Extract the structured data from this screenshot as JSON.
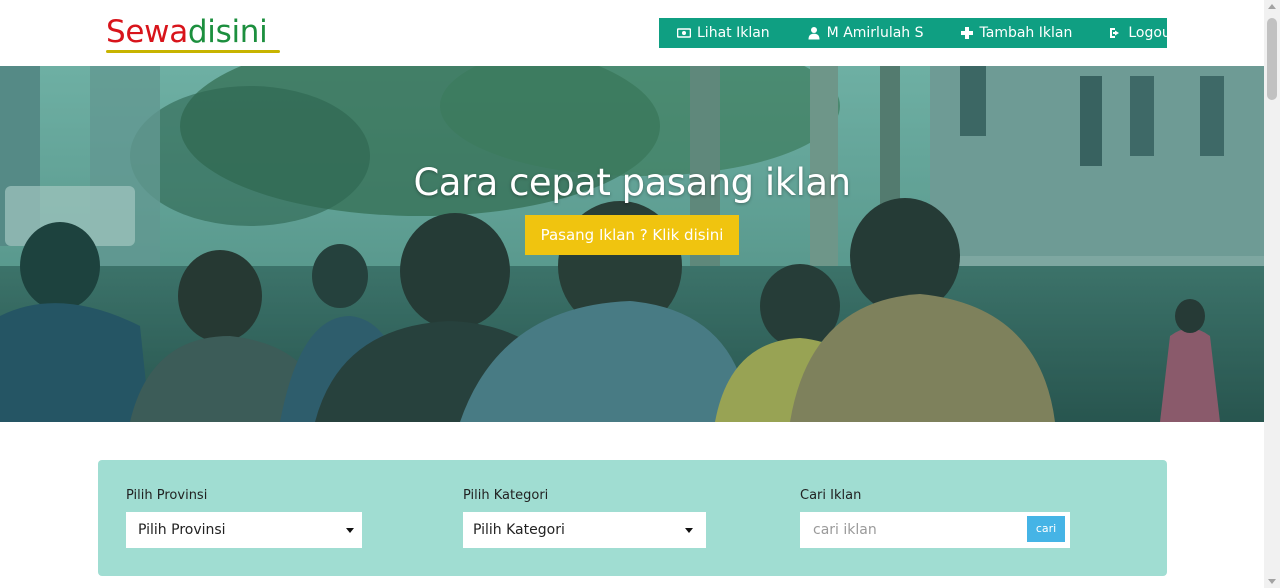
{
  "brand": {
    "part1": "Sewa",
    "part2": "disini"
  },
  "nav": {
    "items": [
      {
        "label": "Lihat Iklan"
      },
      {
        "label": "M Amirlulah S"
      },
      {
        "label": "Tambah Iklan"
      },
      {
        "label": "Logout"
      }
    ]
  },
  "hero": {
    "title": "Cara cepat pasang iklan",
    "button_label": "Pasang Iklan ? Klik disini"
  },
  "search": {
    "province": {
      "label": "Pilih Provinsi",
      "value": "Pilih Provinsi"
    },
    "category": {
      "label": "Pilih Kategori",
      "value": "Pilih Kategori"
    },
    "query": {
      "label": "Cari Iklan",
      "placeholder": "cari iklan",
      "button": "cari"
    }
  },
  "colors": {
    "nav_bg": "#0f9f82",
    "hero_button": "#f0c40f",
    "panel_bg": "#a0ddd2",
    "search_button": "#45b4e6"
  }
}
